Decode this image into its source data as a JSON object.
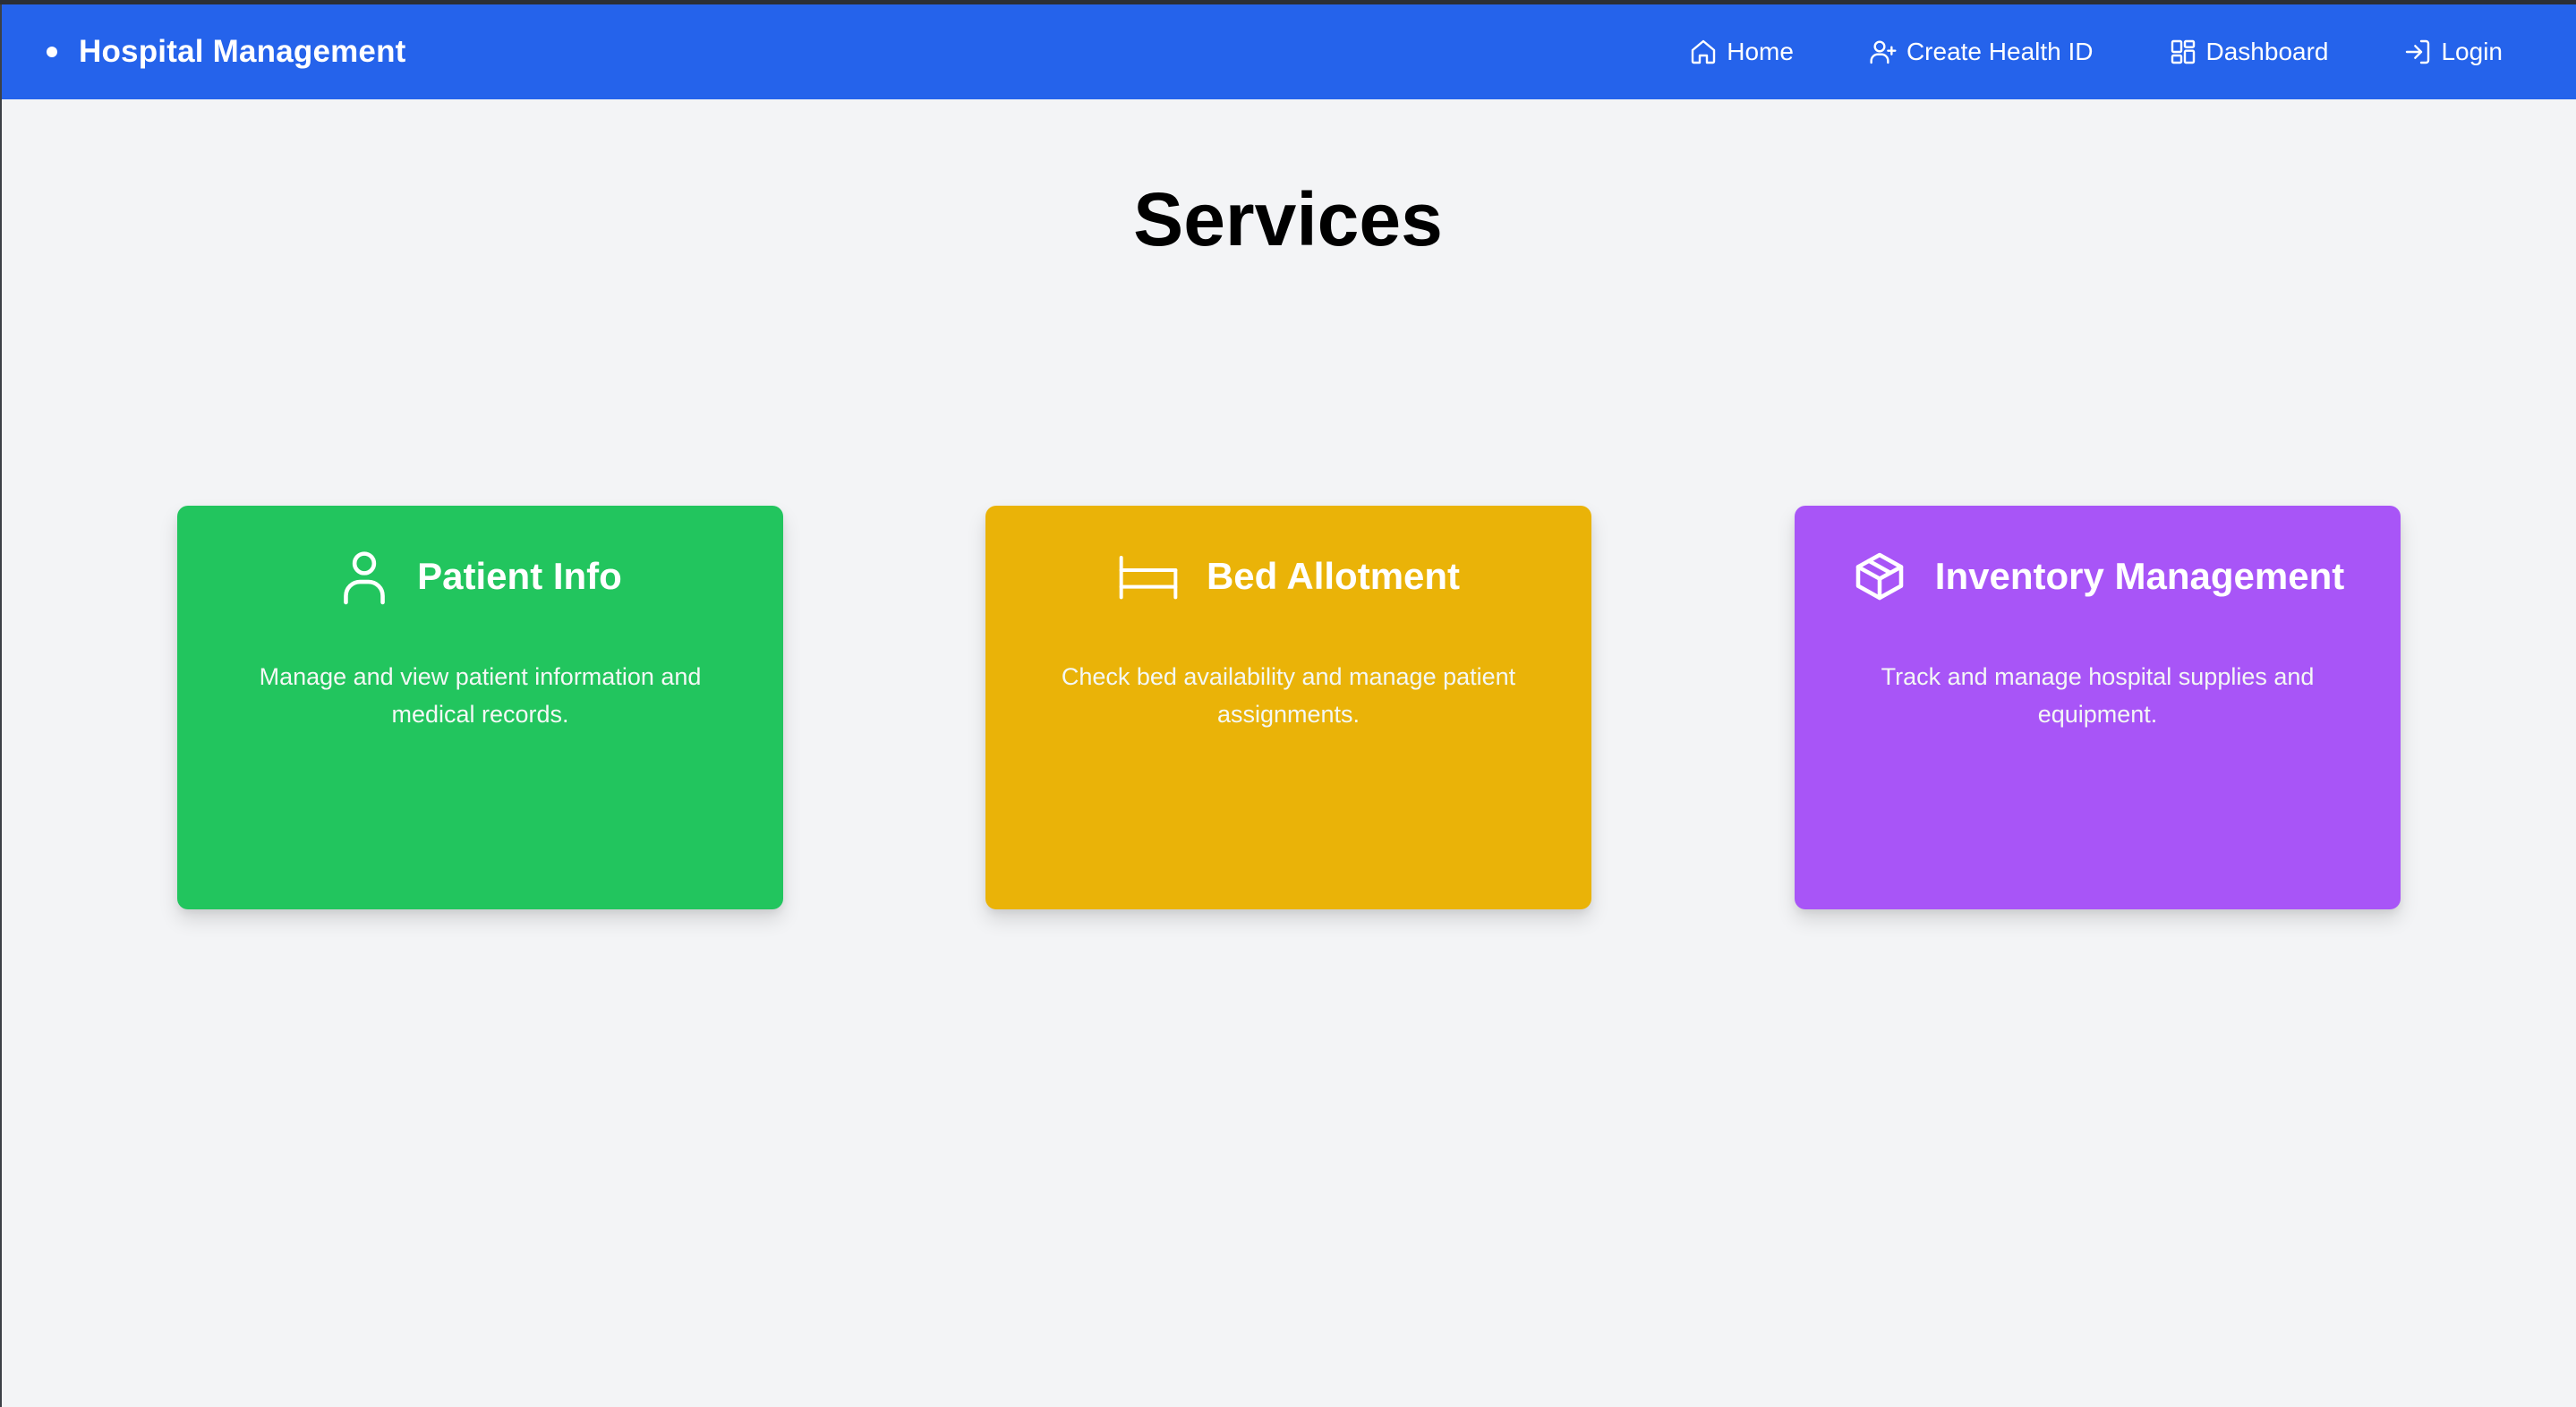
{
  "nav": {
    "brand": "Hospital Management",
    "links": [
      {
        "label": "Home",
        "icon": "home-icon"
      },
      {
        "label": "Create Health ID",
        "icon": "user-plus-icon"
      },
      {
        "label": "Dashboard",
        "icon": "layout-grid-icon"
      },
      {
        "label": "Login",
        "icon": "log-in-icon"
      }
    ],
    "color": "#2563eb"
  },
  "page": {
    "title": "Services",
    "background": "#f3f4f6"
  },
  "services": [
    {
      "title": "Patient Info",
      "description": "Manage and view patient information and medical records.",
      "icon": "user-icon",
      "color": "#22c55e"
    },
    {
      "title": "Bed Allotment",
      "description": "Check bed availability and manage patient assignments.",
      "icon": "bed-icon",
      "color": "#eab308"
    },
    {
      "title": "Inventory Management",
      "description": "Track and manage hospital supplies and equipment.",
      "icon": "package-icon",
      "color": "#a855f7"
    }
  ]
}
